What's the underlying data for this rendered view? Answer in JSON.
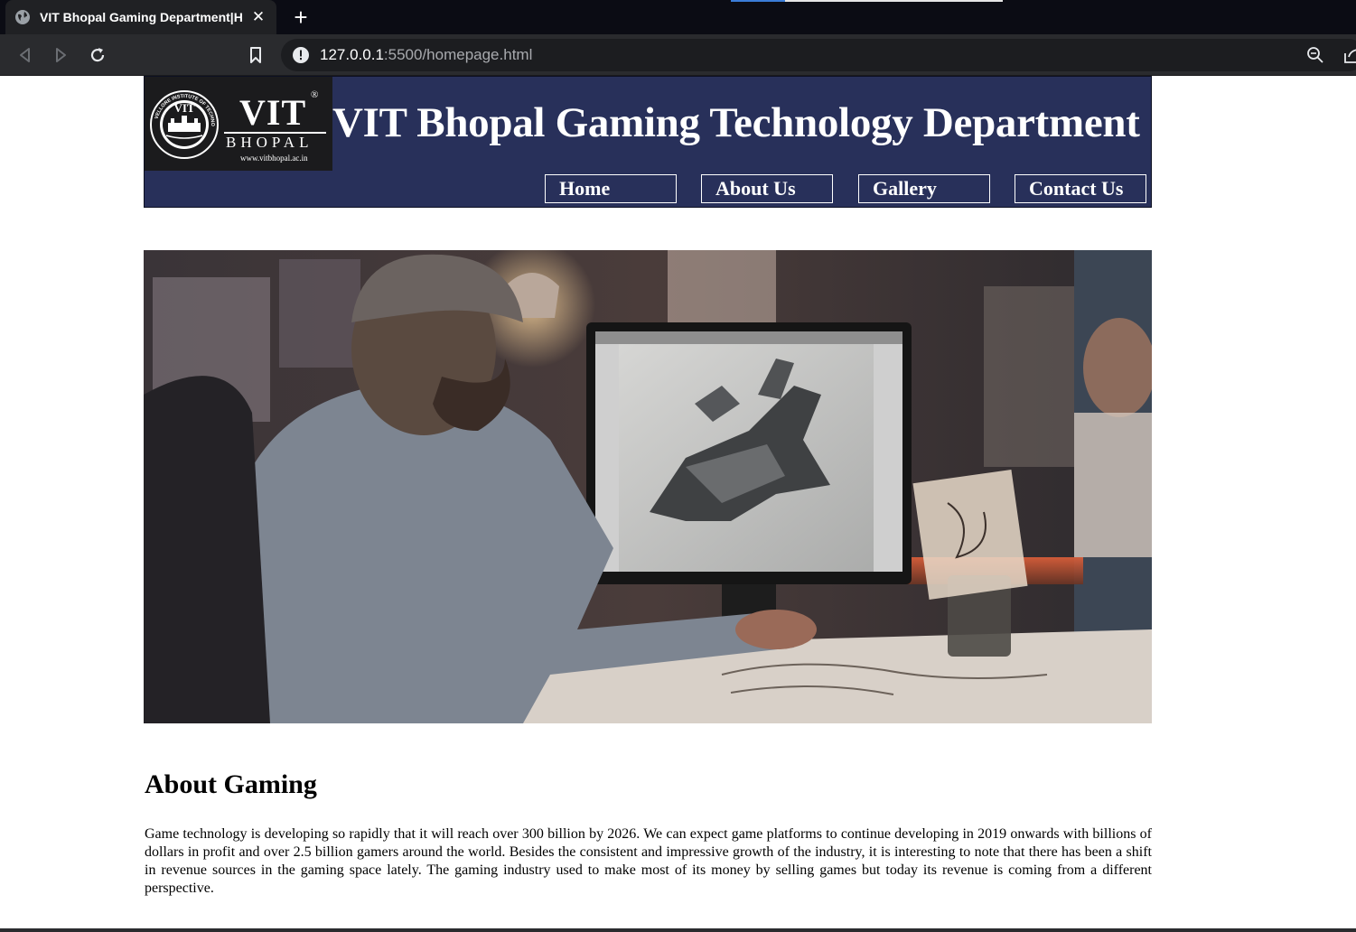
{
  "browser": {
    "tab_title": "VIT Bhopal Gaming Department|H",
    "new_tab_label": "+",
    "close_label": "✕",
    "address": {
      "host": "127.0.0.1",
      "path": ":5500/homepage.html"
    }
  },
  "header": {
    "logo": {
      "name": "VIT",
      "city": "BHOPAL",
      "url": "www.vitbhopal.ac.in",
      "registered": "®",
      "seal_text": "VELLORE INSTITUTE OF TECHNOLOGY",
      "seal_inner": "VIT"
    },
    "title": "VIT Bhopal Gaming Technology Department",
    "nav": [
      {
        "label": "Home"
      },
      {
        "label": "About Us"
      },
      {
        "label": "Gallery"
      },
      {
        "label": "Contact Us"
      }
    ]
  },
  "hero": {
    "icon": "game-designer-photo"
  },
  "about": {
    "heading": "About Gaming",
    "body": "Game technology is developing so rapidly that it will reach over 300 billion by 2026. We can expect game platforms to continue developing in 2019 onwards with billions of dollars in profit and over 2.5 billion gamers around the world. Besides the consistent and impressive growth of the industry, it is interesting to note that there has been a shift in revenue sources in the gaming space lately. The gaming industry used to make most of its money by selling games but today its revenue is coming from a different perspective."
  },
  "colors": {
    "header_bg": "#28305a",
    "logo_bg": "#1b1b1d",
    "chrome_bg": "#2a2b2e",
    "tabbar_bg": "#0b0c14"
  }
}
